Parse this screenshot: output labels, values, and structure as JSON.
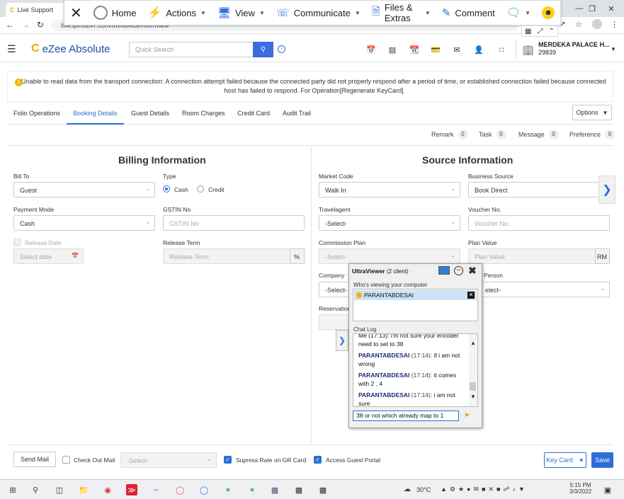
{
  "browser": {
    "tab_title": "Live Support",
    "url": "live.ipms247.com/frontoffice/roomview",
    "window_controls": [
      "minimize",
      "maximize",
      "close"
    ]
  },
  "ultraviewer_toolbar": {
    "items": [
      {
        "label": "Home",
        "icon": "home-icon"
      },
      {
        "label": "Actions",
        "icon": "lightning-icon"
      },
      {
        "label": "View",
        "icon": "monitor-icon"
      },
      {
        "label": "Communicate",
        "icon": "phone-icon"
      },
      {
        "label": "Files & Extras",
        "icon": "files-icon"
      },
      {
        "label": "Comment",
        "icon": "pencil-icon"
      }
    ]
  },
  "app": {
    "logo_text": "eZee Absolute",
    "search_placeholder": "Quick Search",
    "hotel_name": "MERDEKA PALACE H...",
    "hotel_code": "29839"
  },
  "alert": {
    "message": "Unable to read data from the transport connection: A connection attempt failed because the connected party did not properly respond after a period of time, or established connection failed because connected host has failed to respond. For Operation[Regenerate KeyCard]"
  },
  "tabs": [
    "Folio Operations",
    "Booking Details",
    "Guest Details",
    "Room Charges",
    "Credit Card",
    "Audit Trail"
  ],
  "active_tab": "Booking Details",
  "options_label": "Options",
  "counters": [
    {
      "label": "Remark",
      "count": "0"
    },
    {
      "label": "Task",
      "count": "0"
    },
    {
      "label": "Message",
      "count": "0"
    },
    {
      "label": "Preference",
      "count": "0"
    }
  ],
  "billing": {
    "title": "Billing Information",
    "bill_to_label": "Bill To",
    "bill_to_value": "Guest",
    "type_label": "Type",
    "type_options": [
      "Cash",
      "Credit"
    ],
    "type_selected": "Cash",
    "payment_mode_label": "Payment Mode",
    "payment_mode_value": "Cash",
    "gstin_label": "GSTIN No",
    "gstin_placeholder": "GSTIN No",
    "release_date_label": "Release Date",
    "release_date_placeholder": "Select date",
    "release_term_label": "Release Term",
    "release_term_placeholder": "Release Term",
    "percent_symbol": "%"
  },
  "source": {
    "title": "Source Information",
    "market_code_label": "Market Code",
    "market_code_value": "Walk In",
    "business_source_label": "Business Source",
    "business_source_value": "Book Direct",
    "travelagent_label": "Travelagent",
    "travelagent_value": "-Select-",
    "voucher_label": "Voucher No.",
    "voucher_placeholder": "Voucher No.",
    "commission_plan_label": "Commission Plan",
    "commission_plan_value": "-Select-",
    "plan_value_label": "Plan Value",
    "plan_value_placeholder": "Plan Value",
    "currency": "RM",
    "company_label": "Company",
    "company_value": "-Select-",
    "person_label_partial": "Person",
    "person_value_partial": "elect-",
    "reservation_label_partial": "Reservation"
  },
  "footer": {
    "send_mail": "Send Mail",
    "check_out_mail": "Check Out Mail",
    "select_placeholder": "-Select-",
    "supress_rate": "Supress Rate on GR Card",
    "access_portal": "Access Guest Portal",
    "key_card": "Key Card",
    "save": "Save"
  },
  "ultraviewer_chat": {
    "title": "UltraViewer",
    "subtitle": "(2 client)",
    "viewing_label": "Who's viewing your computer",
    "viewer_name": "PARANTABDESAI",
    "chat_log_label": "Chat Log",
    "messages": [
      {
        "who": "",
        "time": "",
        "text": "Me (17:13): i'm not sure your encoder"
      },
      {
        "who": "",
        "time": "",
        "text": "need to set to 38"
      },
      {
        "who": "PARANTABDESAI",
        "time": "(17:14):",
        "text": "if i am not wrong"
      },
      {
        "who": "PARANTABDESAI",
        "time": "(17:14):",
        "text": "it comes with 2 , 4"
      },
      {
        "who": "PARANTABDESAI",
        "time": "(17:14):",
        "text": "i am not sure"
      }
    ],
    "input_value": "38 or not which already map to 1"
  },
  "taskbar": {
    "temperature": "30°C",
    "time": "5:15 PM",
    "date": "3/3/2022"
  }
}
